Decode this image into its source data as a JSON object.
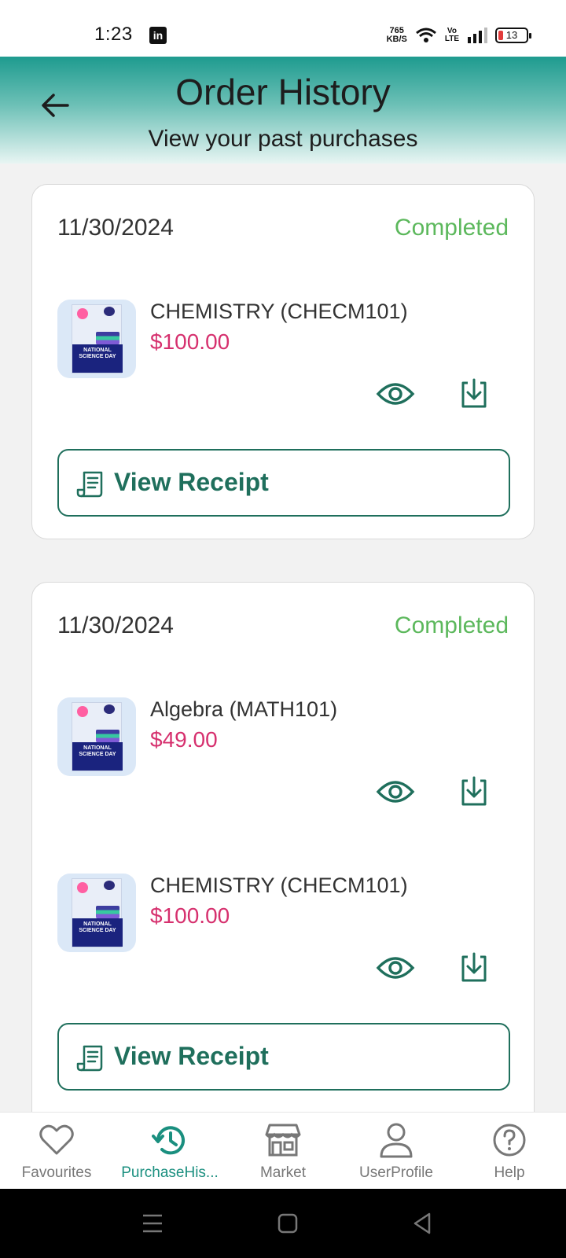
{
  "status_bar": {
    "time": "1:23",
    "app_icon": "linkedin-icon",
    "net_speed_value": "765",
    "net_speed_unit": "KB/S",
    "volte_top": "Vo",
    "volte_bottom": "LTE",
    "battery": "13"
  },
  "header": {
    "title": "Order History",
    "subtitle": "View your past purchases",
    "back_icon": "arrow-left-icon"
  },
  "orders": [
    {
      "date": "11/30/2024",
      "status": "Completed",
      "items": [
        {
          "name": "CHEMISTRY (CHECM101)",
          "price": "$100.00",
          "thumb_text": "NATIONAL SCIENCE DAY"
        }
      ],
      "receipt_label": "View Receipt"
    },
    {
      "date": "11/30/2024",
      "status": "Completed",
      "items": [
        {
          "name": "Algebra (MATH101)",
          "price": "$49.00",
          "thumb_text": "NATIONAL SCIENCE DAY"
        },
        {
          "name": "CHEMISTRY (CHECM101)",
          "price": "$100.00",
          "thumb_text": "NATIONAL SCIENCE DAY"
        }
      ],
      "receipt_label": "View Receipt"
    }
  ],
  "bottom_nav": [
    {
      "label": "Favourites",
      "icon": "heart-icon",
      "active": false
    },
    {
      "label": "PurchaseHis...",
      "icon": "history-icon",
      "active": true
    },
    {
      "label": "Market",
      "icon": "store-icon",
      "active": false
    },
    {
      "label": "UserProfile",
      "icon": "user-icon",
      "active": false
    },
    {
      "label": "Help",
      "icon": "help-icon",
      "active": false
    }
  ],
  "colors": {
    "accent": "#1f6f5c",
    "status_completed": "#5cb85c",
    "price": "#d6306e",
    "nav_active": "#1a8f7f"
  }
}
